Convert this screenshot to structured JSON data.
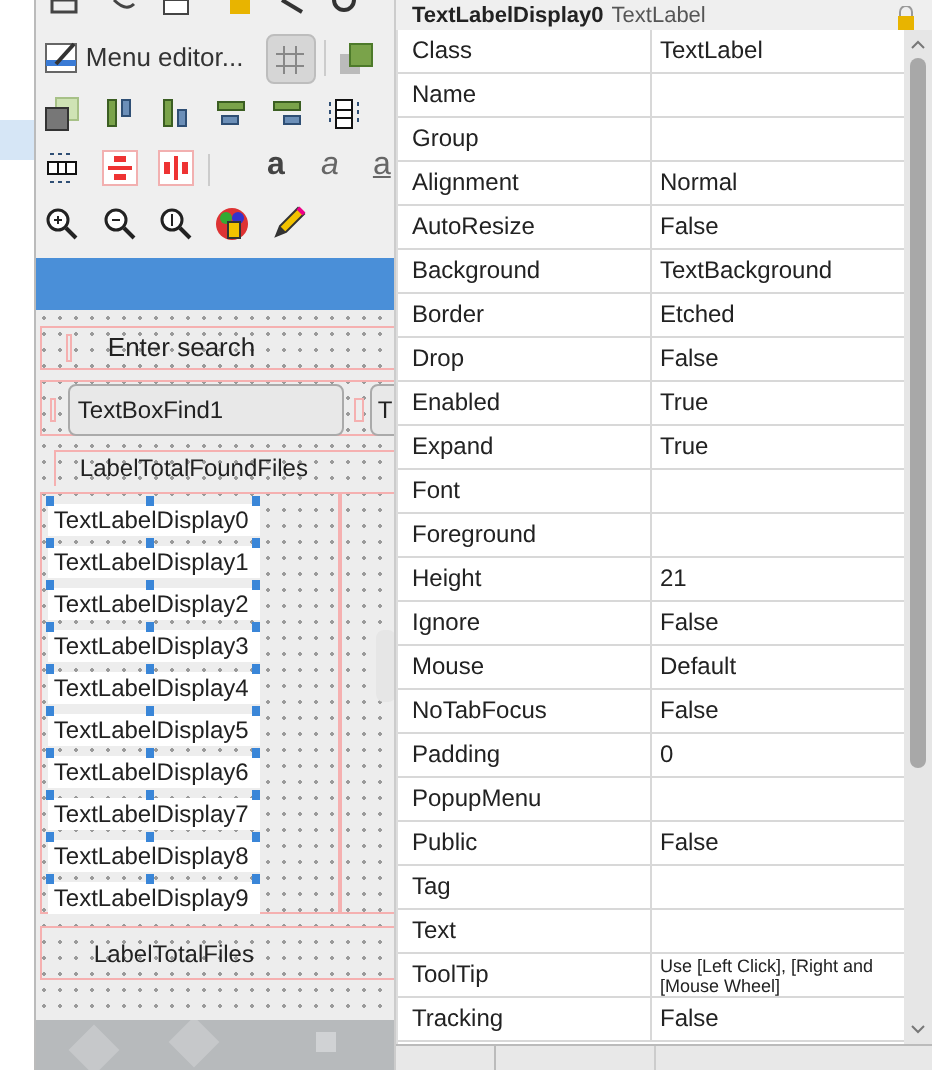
{
  "toolbar": {
    "menu_editor": "Menu editor...",
    "grid_toggle": {
      "on": true
    },
    "font_buttons": [
      {
        "label": "a",
        "kind": "bold"
      },
      {
        "label": "a",
        "kind": "italic"
      },
      {
        "label": "a",
        "kind": "underline"
      }
    ]
  },
  "form": {
    "search_label": "Enter search",
    "search_field": "TextBoxFind1",
    "second_field": "T",
    "found_label": "LabelTotalFoundFiles",
    "display_labels": [
      "TextLabelDisplay0",
      "TextLabelDisplay1",
      "TextLabelDisplay2",
      "TextLabelDisplay3",
      "TextLabelDisplay4",
      "TextLabelDisplay5",
      "TextLabelDisplay6",
      "TextLabelDisplay7",
      "TextLabelDisplay8",
      "TextLabelDisplay9"
    ],
    "total_label": "LabelTotalFiles"
  },
  "properties": {
    "header_name": "TextLabelDisplay0",
    "header_class": "TextLabel",
    "rows": [
      {
        "name": "Class",
        "value": "TextLabel"
      },
      {
        "name": "Name",
        "value": ""
      },
      {
        "name": "Group",
        "value": ""
      },
      {
        "name": "Alignment",
        "value": "Normal"
      },
      {
        "name": "AutoResize",
        "value": "False"
      },
      {
        "name": "Background",
        "value": "TextBackground"
      },
      {
        "name": "Border",
        "value": "Etched"
      },
      {
        "name": "Drop",
        "value": "False"
      },
      {
        "name": "Enabled",
        "value": "True"
      },
      {
        "name": "Expand",
        "value": "True"
      },
      {
        "name": "Font",
        "value": ""
      },
      {
        "name": "Foreground",
        "value": ""
      },
      {
        "name": "Height",
        "value": "21"
      },
      {
        "name": "Ignore",
        "value": "False"
      },
      {
        "name": "Mouse",
        "value": "Default"
      },
      {
        "name": "NoTabFocus",
        "value": "False"
      },
      {
        "name": "Padding",
        "value": "0"
      },
      {
        "name": "PopupMenu",
        "value": ""
      },
      {
        "name": "Public",
        "value": "False"
      },
      {
        "name": "Tag",
        "value": ""
      },
      {
        "name": "Text",
        "value": ""
      },
      {
        "name": "ToolTip",
        "value": "Use [Left Click], [Right and [Mouse Wheel]"
      },
      {
        "name": "Tracking",
        "value": "False"
      }
    ]
  }
}
